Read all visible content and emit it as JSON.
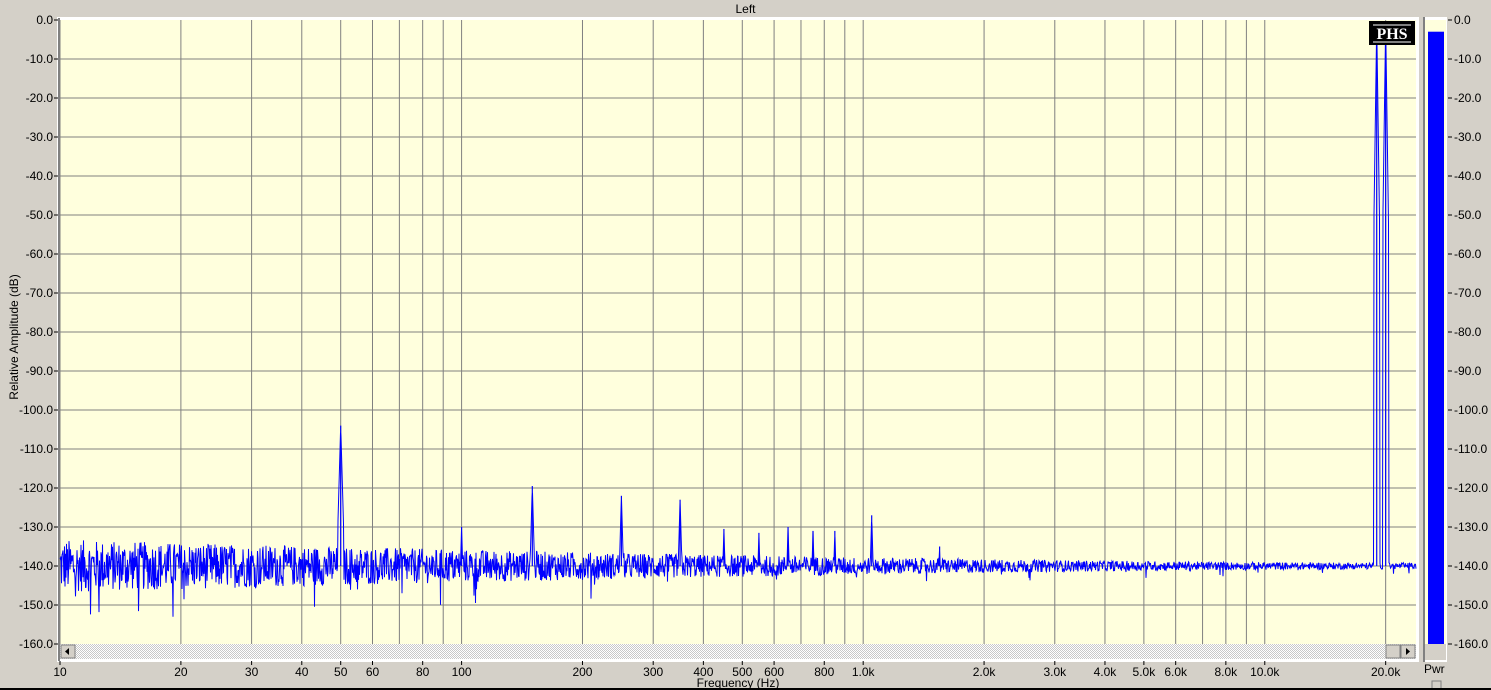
{
  "chart_data": {
    "type": "line",
    "title": "Left",
    "xlabel": "Frequency (Hz)",
    "ylabel": "Relative Amplitude (dB)",
    "xscale": "log",
    "xlim": [
      10,
      23800
    ],
    "ylim": [
      -160,
      0
    ],
    "grid": true,
    "logo": "PHS",
    "x_ticks": [
      {
        "v": 10,
        "label": "10"
      },
      {
        "v": 20,
        "label": "20"
      },
      {
        "v": 30,
        "label": "30"
      },
      {
        "v": 40,
        "label": "40"
      },
      {
        "v": 50,
        "label": "50"
      },
      {
        "v": 60,
        "label": "60"
      },
      {
        "v": 80,
        "label": "80"
      },
      {
        "v": 100,
        "label": "100"
      },
      {
        "v": 200,
        "label": "200"
      },
      {
        "v": 300,
        "label": "300"
      },
      {
        "v": 400,
        "label": "400"
      },
      {
        "v": 500,
        "label": "500"
      },
      {
        "v": 600,
        "label": "600"
      },
      {
        "v": 800,
        "label": "800"
      },
      {
        "v": 1000,
        "label": "1.0k"
      },
      {
        "v": 2000,
        "label": "2.0k"
      },
      {
        "v": 3000,
        "label": "3.0k"
      },
      {
        "v": 4000,
        "label": "4.0k"
      },
      {
        "v": 5000,
        "label": "5.0k"
      },
      {
        "v": 6000,
        "label": "6.0k"
      },
      {
        "v": 8000,
        "label": "8.0k"
      },
      {
        "v": 10000,
        "label": "10.0k"
      },
      {
        "v": 20000,
        "label": "20.0k"
      }
    ],
    "x_grid": [
      10,
      20,
      30,
      40,
      50,
      60,
      70,
      80,
      90,
      100,
      200,
      300,
      400,
      500,
      600,
      700,
      800,
      900,
      1000,
      2000,
      3000,
      4000,
      5000,
      6000,
      7000,
      8000,
      9000,
      10000,
      20000
    ],
    "y_ticks": [
      "0.0",
      "-10.0",
      "-20.0",
      "-30.0",
      "-40.0",
      "-50.0",
      "-60.0",
      "-70.0",
      "-80.0",
      "-90.0",
      "-100.0",
      "-110.0",
      "-120.0",
      "-130.0",
      "-140.0",
      "-150.0",
      "-160.0"
    ],
    "noise_floor_db": -140,
    "series": [
      {
        "name": "Left",
        "color": "#0000ff",
        "peaks": [
          {
            "f": 50,
            "db": -104
          },
          {
            "f": 100,
            "db": -130
          },
          {
            "f": 150,
            "db": -119.5
          },
          {
            "f": 250,
            "db": -122
          },
          {
            "f": 350,
            "db": -123
          },
          {
            "f": 450,
            "db": -130.5
          },
          {
            "f": 550,
            "db": -131.5
          },
          {
            "f": 650,
            "db": -130
          },
          {
            "f": 750,
            "db": -131
          },
          {
            "f": 850,
            "db": -131
          },
          {
            "f": 1050,
            "db": -127
          },
          {
            "f": 1550,
            "db": -135
          },
          {
            "f": 19000,
            "db": -1
          },
          {
            "f": 20000,
            "db": -1
          }
        ]
      }
    ],
    "power_meter": {
      "label": "Pwr",
      "value_db": -3,
      "ylim": [
        -160,
        0
      ],
      "color": "#0000ff"
    }
  }
}
